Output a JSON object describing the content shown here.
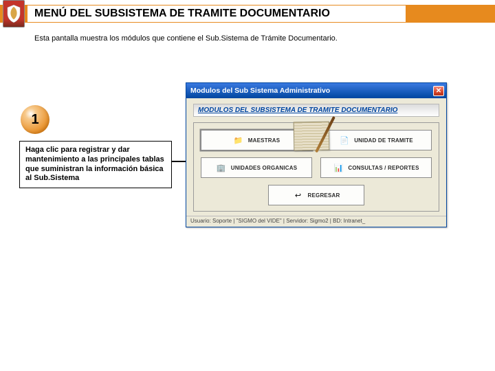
{
  "header": {
    "title": "MENÚ DEL SUBSISTEMA DE TRAMITE DOCUMENTARIO"
  },
  "subtitle": "Esta pantalla muestra los módulos que contiene el Sub.Sistema de Trámite Documentario.",
  "badge": "1",
  "callout": "Haga clic para registrar y dar mantenimiento a las principales tablas que suministran la información básica al Sub.Sistema",
  "dialog": {
    "title": "Modulos del Sub Sistema Administrativo",
    "close": "✕",
    "heading": "MODULOS DEL SUBSISTEMA DE TRAMITE DOCUMENTARIO",
    "buttons": {
      "maestras": "MAESTRAS",
      "unidad_tramite": "UNIDAD DE TRAMITE",
      "unidades_organicas": "UNIDADES ORGANICAS",
      "consultas_reportes": "CONSULTAS / REPORTES",
      "regresar": "REGRESAR"
    },
    "status": "Usuario: Soporte | \"SIGMO del VIDE\" | Servidor: Sigmo2 | BD: Intranet_"
  }
}
